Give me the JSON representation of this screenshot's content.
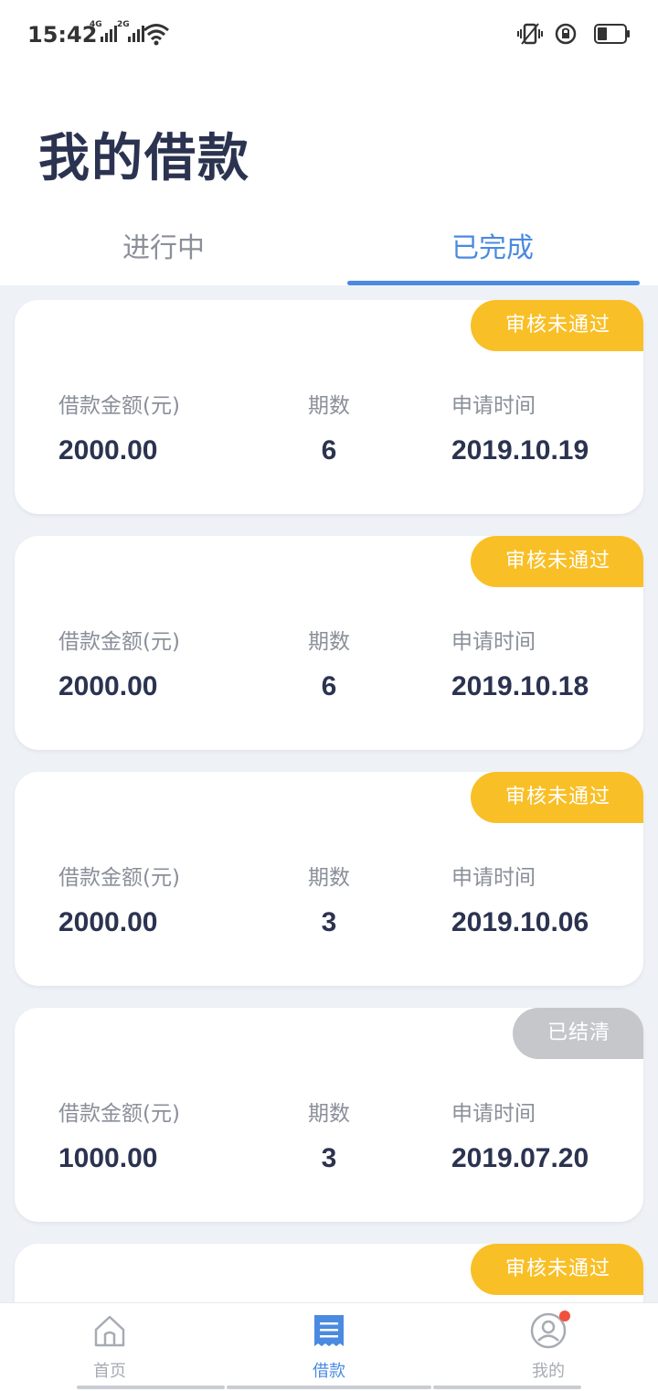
{
  "status_bar": {
    "time": "15:42",
    "signal_1": "4G",
    "signal_2": "2G",
    "icons": [
      "wifi-icon",
      "vibrate-icon",
      "rotation-lock-icon",
      "battery-icon"
    ]
  },
  "page": {
    "title": "我的借款"
  },
  "tabs": [
    {
      "label": "进行中",
      "active": false
    },
    {
      "label": "已完成",
      "active": true
    }
  ],
  "columns": {
    "amount": "借款金额(元)",
    "periods": "期数",
    "date": "申请时间"
  },
  "loans": [
    {
      "badge": "审核未通过",
      "status": "rejected",
      "amount": "2000.00",
      "periods": "6",
      "date": "2019.10.19"
    },
    {
      "badge": "审核未通过",
      "status": "rejected",
      "amount": "2000.00",
      "periods": "6",
      "date": "2019.10.18"
    },
    {
      "badge": "审核未通过",
      "status": "rejected",
      "amount": "2000.00",
      "periods": "3",
      "date": "2019.10.06"
    },
    {
      "badge": "已结清",
      "status": "settled",
      "amount": "1000.00",
      "periods": "3",
      "date": "2019.07.20"
    },
    {
      "badge": "审核未通过",
      "status": "rejected",
      "amount": "",
      "periods": "",
      "date": ""
    }
  ],
  "tabbar": [
    {
      "label": "首页",
      "icon": "home-icon",
      "active": false
    },
    {
      "label": "借款",
      "icon": "loan-document-icon",
      "active": true
    },
    {
      "label": "我的",
      "icon": "profile-icon",
      "active": false,
      "has_notification": true
    }
  ],
  "colors": {
    "accent": "#4a8ae0",
    "rejected_badge": "#f9bf27",
    "settled_badge": "#c6c7cb",
    "title": "#2b3350",
    "list_background": "#eef2f7",
    "notification": "#f2503c"
  }
}
